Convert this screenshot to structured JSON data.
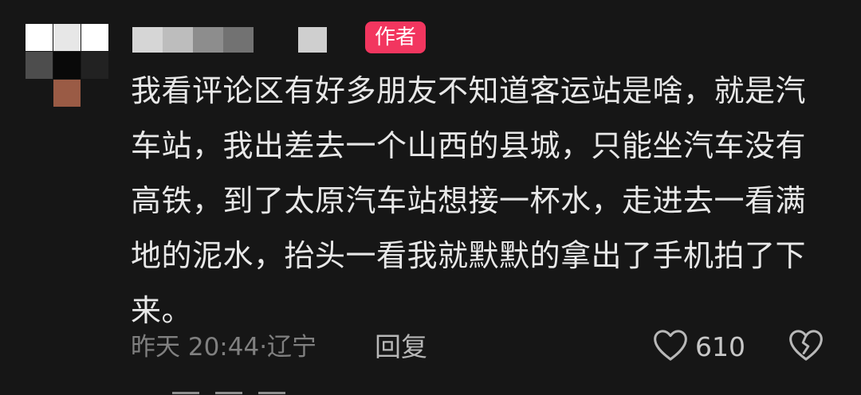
{
  "comment": {
    "author_badge": "作者",
    "text": "我看评论区有好多朋友不知道客运站是啥，就是汽车站，我出差去一个山西的县城，只能坐汽车没有高铁，到了太原汽车站想接一杯水，走进去一看满地的泥水，抬头一看我就默默的拿出了手机拍了下来。",
    "meta": "昨天 20:44·辽宁",
    "reply_label": "回复",
    "like_count": "610",
    "like_icon": "heart-outline-icon",
    "dislike_icon": "broken-heart-icon"
  },
  "colors": {
    "background": "#161616",
    "badge": "#f2365f",
    "text": "#e8e8e8",
    "meta": "#808080"
  }
}
